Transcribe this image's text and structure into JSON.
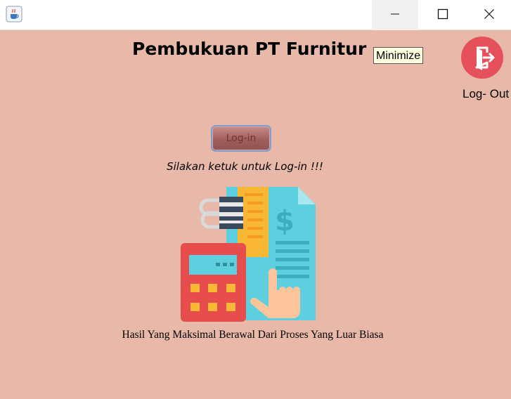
{
  "window": {
    "app_icon": "java-cup-icon",
    "controls": {
      "minimize_icon": "minimize-icon",
      "maximize_icon": "maximize-icon",
      "close_icon": "close-icon"
    }
  },
  "header": {
    "title": "Pembukuan PT Furnitur",
    "tooltip": "Minimize"
  },
  "logout": {
    "icon": "logout-door-icon",
    "label": "Log- Out"
  },
  "login": {
    "button_label": "Log-in",
    "hint": "Silakan ketuk untuk Log-in !!!"
  },
  "illustration": {
    "icon": "accounting-calculator-invoice-icon"
  },
  "footer": {
    "tagline": "Hasil Yang Maksimal Berawal Dari Proses Yang Luar Biasa"
  },
  "colors": {
    "background": "#e8b9a8",
    "logout_red": "#e5505a",
    "calculator_red": "#e84d4d",
    "document_blue": "#5ecfdf",
    "accent_yellow": "#f8b734"
  }
}
